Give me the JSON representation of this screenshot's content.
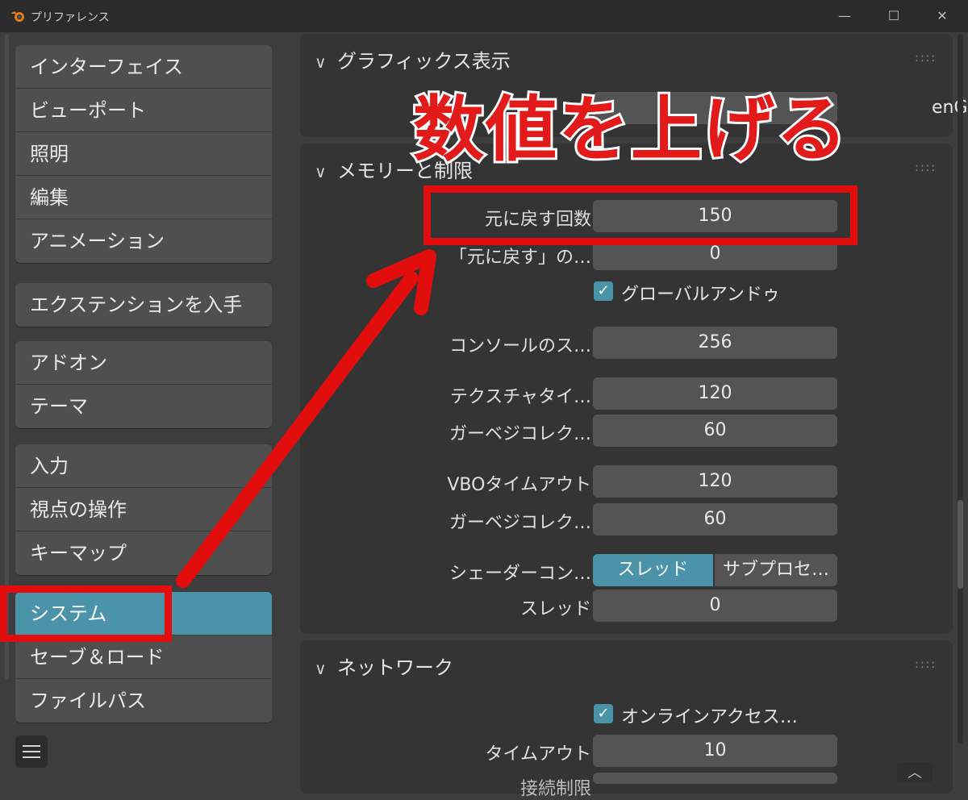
{
  "window": {
    "title": "プリファレンス",
    "minimize_icon": "minimize-icon",
    "maximize_icon": "maximize-icon",
    "close_icon": "close-icon"
  },
  "sidebar": {
    "groups": [
      {
        "items": [
          {
            "label": "インターフェイス"
          },
          {
            "label": "ビューポート"
          },
          {
            "label": "照明"
          },
          {
            "label": "編集"
          },
          {
            "label": "アニメーション"
          }
        ]
      },
      {
        "items": [
          {
            "label": "エクステンションを入手"
          }
        ]
      },
      {
        "items": [
          {
            "label": "アドオン"
          },
          {
            "label": "テーマ"
          }
        ]
      },
      {
        "items": [
          {
            "label": "入力"
          },
          {
            "label": "視点の操作"
          },
          {
            "label": "キーマップ"
          }
        ]
      },
      {
        "items": [
          {
            "label": "システム",
            "active": true
          },
          {
            "label": "セーブ＆ロード"
          },
          {
            "label": "ファイルパス"
          }
        ]
      }
    ]
  },
  "panels": {
    "graphics": {
      "title": "グラフィックス表示",
      "partial_value": "enG"
    },
    "memory": {
      "title": "メモリーと制限",
      "undo_steps": {
        "label": "元に戻す回数",
        "value": "150"
      },
      "undo_memory": {
        "label": "「元に戻す」の…",
        "value": "0"
      },
      "global_undo": {
        "label": "グローバルアンドゥ",
        "checked": true
      },
      "console_scrollback": {
        "label": "コンソールのス…",
        "value": "256"
      },
      "texture_timeout": {
        "label": "テクスチャタイ…",
        "value": "120"
      },
      "texture_gc": {
        "label": "ガーベジコレク…",
        "value": "60"
      },
      "vbo_timeout": {
        "label": "VBOタイムアウト",
        "value": "120"
      },
      "vbo_gc": {
        "label": "ガーベジコレク…",
        "value": "60"
      },
      "shader_compile": {
        "label": "シェーダーコン…",
        "options": [
          "スレッド",
          "サブプロセ…"
        ],
        "selected": "スレッド"
      },
      "threads": {
        "label": "スレッド",
        "value": "0"
      }
    },
    "network": {
      "title": "ネットワーク",
      "online_access": {
        "label": "オンラインアクセス…",
        "checked": true
      },
      "timeout": {
        "label": "タイムアウト",
        "value": "10"
      },
      "partial_label": "接続制限"
    }
  },
  "annotation": {
    "text": "数値を上げる",
    "color": "#e21a1a"
  },
  "colors": {
    "accent": "#4b93a8",
    "highlight": "#e20e0e"
  }
}
